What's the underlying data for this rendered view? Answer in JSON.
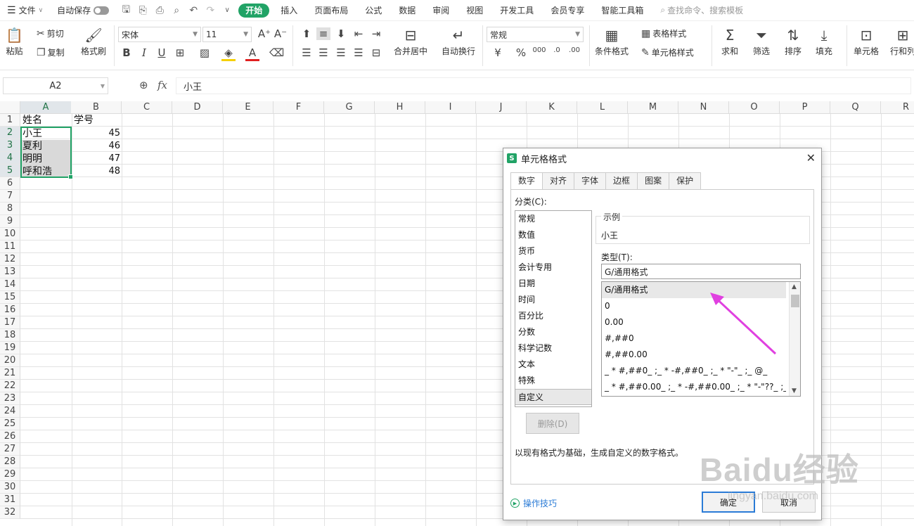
{
  "menubar": {
    "file": "文件",
    "autosave": "自动保存",
    "tabs": [
      "开始",
      "插入",
      "页面布局",
      "公式",
      "数据",
      "审阅",
      "视图",
      "开发工具",
      "会员专享",
      "智能工具箱"
    ],
    "active_tab": "开始",
    "search_placeholder": "查找命令、搜索模板"
  },
  "ribbon": {
    "paste": "粘贴",
    "cut": "剪切",
    "copy": "复制",
    "format_painter": "格式刷",
    "font_name": "宋体",
    "font_size": "11",
    "number_format": "常规",
    "merge_center": "合并居中",
    "wrap_text": "自动换行",
    "table_style": "表格样式",
    "conditional_format": "条件格式",
    "cell_style": "单元格样式",
    "sum": "求和",
    "filter": "筛选",
    "sort": "排序",
    "fill": "填充",
    "cell": "单元格",
    "row_col": "行和列",
    "bold": "B",
    "italic": "I",
    "underline": "U",
    "currency_symbol": "¥",
    "percent": "%"
  },
  "formula_bar": {
    "name_box": "A2",
    "fx": "fx",
    "value": "小王"
  },
  "sheet": {
    "columns": [
      "A",
      "B",
      "C",
      "D",
      "E",
      "F",
      "G",
      "H",
      "I",
      "J",
      "K",
      "L",
      "M",
      "N",
      "O",
      "P",
      "Q",
      "R"
    ],
    "rows": [
      "1",
      "2",
      "3",
      "4",
      "5",
      "6",
      "7",
      "8",
      "9",
      "10",
      "11",
      "12",
      "13",
      "14",
      "15",
      "16",
      "17",
      "18",
      "19",
      "20",
      "21",
      "22",
      "23",
      "24",
      "25",
      "26",
      "27",
      "28",
      "29",
      "30",
      "31",
      "32"
    ],
    "cells": {
      "A1": "姓名",
      "B1": "学号",
      "A2": "小王",
      "B2": "45",
      "A3": "夏利",
      "B3": "46",
      "A4": "明明",
      "B4": "47",
      "A5": "呼和浩",
      "B5": "48"
    },
    "selected_range": "A2:A5",
    "selection_color": "#21a366"
  },
  "dialog": {
    "title": "单元格格式",
    "tabs": [
      "数字",
      "对齐",
      "字体",
      "边框",
      "图案",
      "保护"
    ],
    "active_tab": "数字",
    "category_label": "分类(C):",
    "categories": [
      "常规",
      "数值",
      "货币",
      "会计专用",
      "日期",
      "时间",
      "百分比",
      "分数",
      "科学记数",
      "文本",
      "特殊",
      "自定义"
    ],
    "selected_category": "自定义",
    "sample_label": "示例",
    "sample_value": "小王",
    "type_label": "类型(T):",
    "type_value": "G/通用格式",
    "type_list": [
      "G/通用格式",
      "0",
      "0.00",
      "#,##0",
      "#,##0.00",
      "_ * #,##0_ ;_ * -#,##0_ ;_ * \"-\"_ ;_ @_",
      "_ * #,##0.00_ ;_ * -#,##0.00_ ;_ * \"-\"??_ ;_ @_"
    ],
    "selected_type": "G/通用格式",
    "delete_button": "删除(D)",
    "description": "以现有格式为基础，生成自定义的数字格式。",
    "tips_link": "操作技巧",
    "ok_button": "确定",
    "cancel_button": "取消"
  },
  "annotation": {
    "arrow_color": "#e040e0"
  },
  "watermark": {
    "main": "Baidu经验",
    "sub": "jingyan.baidu.com"
  },
  "colors": {
    "accent": "#21a366",
    "link": "#2a7bd6"
  }
}
